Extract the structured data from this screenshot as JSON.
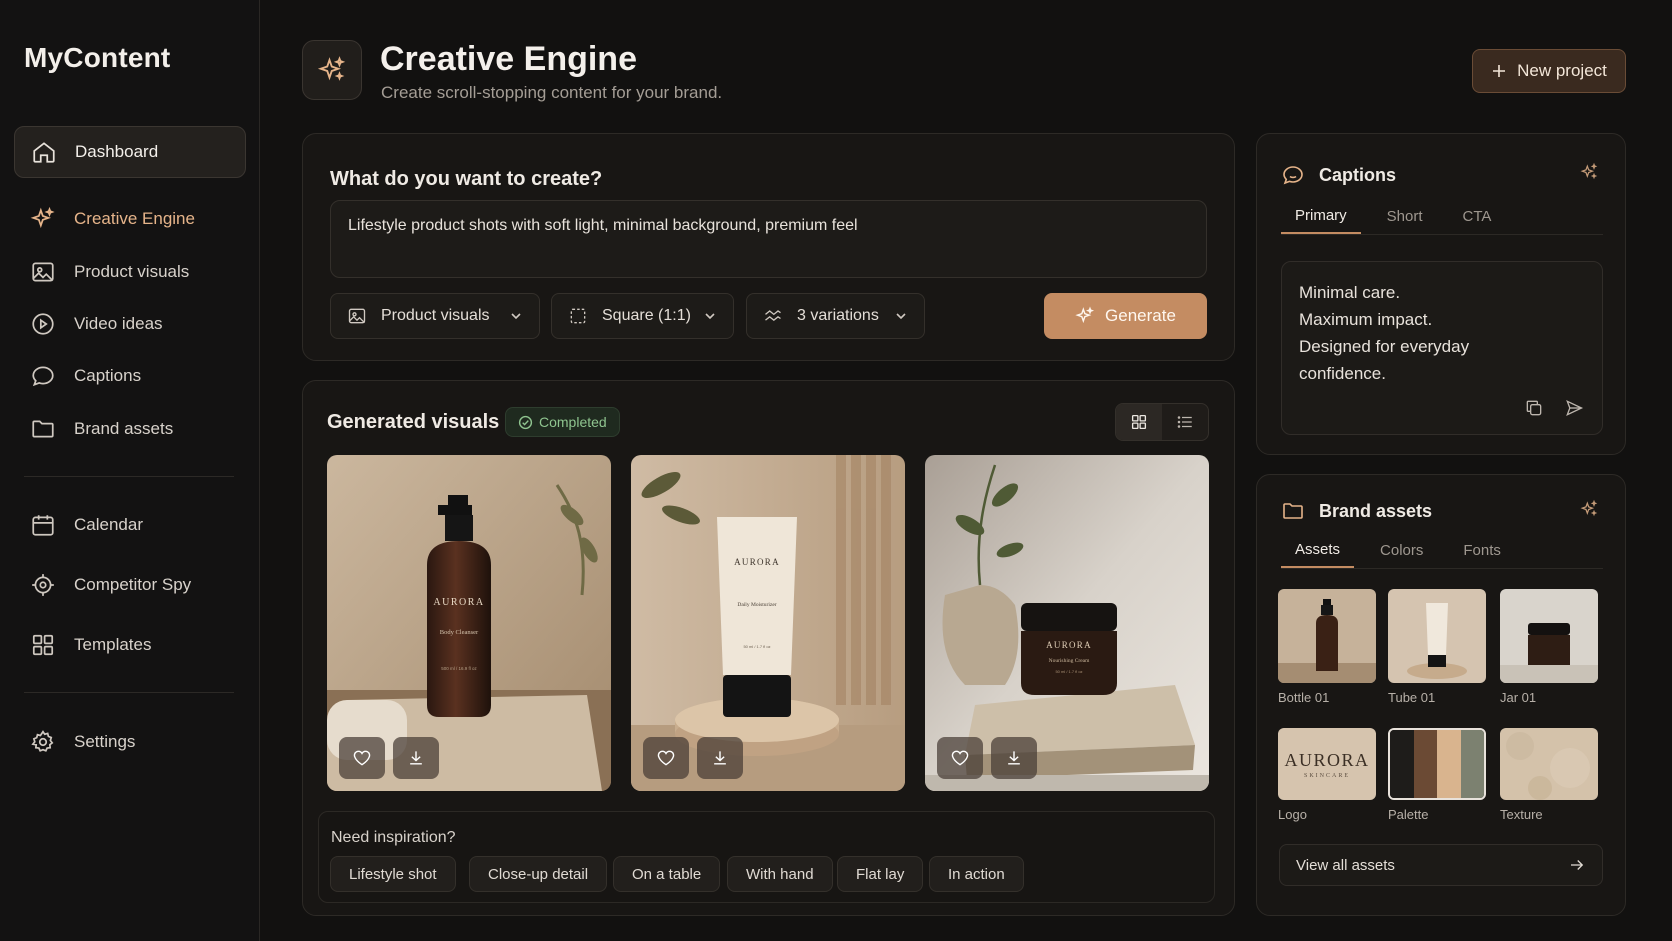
{
  "app": {
    "brand": "MyContent"
  },
  "sidebar": {
    "items": [
      {
        "label": "Dashboard",
        "icon": "home-icon"
      },
      {
        "label": "Creative Engine",
        "icon": "sparkle-icon"
      },
      {
        "label": "Product visuals",
        "icon": "image-icon"
      },
      {
        "label": "Video ideas",
        "icon": "play-icon"
      },
      {
        "label": "Captions",
        "icon": "chat-icon"
      },
      {
        "label": "Brand assets",
        "icon": "folder-icon"
      },
      {
        "label": "Calendar",
        "icon": "calendar-icon"
      },
      {
        "label": "Competitor Spy",
        "icon": "crosshair-icon"
      },
      {
        "label": "Templates",
        "icon": "grid-icon"
      },
      {
        "label": "Settings",
        "icon": "gear-icon"
      }
    ]
  },
  "header": {
    "title": "Creative Engine",
    "subtitle": "Create scroll-stopping content for your brand.",
    "new_project": "New project"
  },
  "create": {
    "title": "What do you want to create?",
    "prompt": "Lifestyle product shots with soft light, minimal background, premium feel",
    "type": "Product visuals",
    "format": "Square (1:1)",
    "variations": "3 variations",
    "generate": "Generate"
  },
  "visuals": {
    "title": "Generated visuals",
    "status": "Completed",
    "items": [
      {
        "brand": "AURORA",
        "product": "Body Cleanser",
        "size": "500 ml / 16.9 fl oz"
      },
      {
        "brand": "AURORA",
        "product": "Daily Moisturizer",
        "size": "50 ml / 1.7 fl oz"
      },
      {
        "brand": "AURORA",
        "product": "Nourishing Cream",
        "size": "50 ml / 1.7 fl oz"
      }
    ],
    "inspiration_title": "Need inspiration?",
    "chips": [
      "Lifestyle shot",
      "Close-up detail",
      "On a table",
      "With hand",
      "Flat lay",
      "In action"
    ]
  },
  "captions": {
    "title": "Captions",
    "tabs": [
      "Primary",
      "Short",
      "CTA"
    ],
    "lines": [
      "Minimal care.",
      "Maximum impact.",
      "Designed for everyday",
      "confidence."
    ]
  },
  "assets": {
    "title": "Brand assets",
    "tabs": [
      "Assets",
      "Colors",
      "Fonts"
    ],
    "items": [
      "Bottle 01",
      "Tube 01",
      "Jar 01",
      "Logo",
      "Palette",
      "Texture"
    ],
    "logo_text": "AURORA",
    "logo_sub": "SKINCARE",
    "view_all": "View all assets",
    "palette": [
      "#1e1c1a",
      "#6b4a34",
      "#d9b48e",
      "#7c8170"
    ]
  },
  "colors": {
    "accent": "#c48c62",
    "active_nav": "#e6b48a",
    "success": "#8fc48f"
  }
}
